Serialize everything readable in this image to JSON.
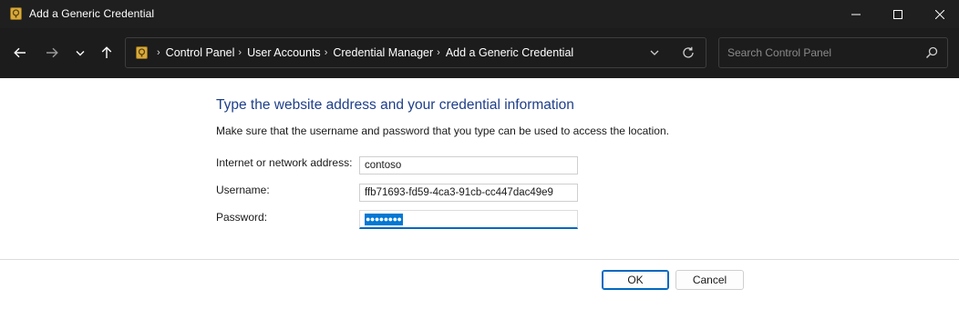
{
  "window": {
    "title": "Add a Generic Credential"
  },
  "nav": {
    "breadcrumbs": [
      "Control Panel",
      "User Accounts",
      "Credential Manager",
      "Add a Generic Credential"
    ],
    "search_placeholder": "Search Control Panel"
  },
  "form": {
    "heading": "Type the website address and your credential information",
    "instructions": "Make sure that the username and password that you type can be used to access the location.",
    "address_label": "Internet or network address:",
    "address_value": "contoso",
    "username_label": "Username:",
    "username_value": "ffb71693-fd59-4ca3-91cb-cc447dac49e9",
    "password_label": "Password:",
    "password_masked": "●●●●●●●●"
  },
  "buttons": {
    "ok_label": "OK",
    "cancel_label": "Cancel"
  },
  "icons": {
    "app": "credential-manager-icon",
    "back": "arrow-left-icon",
    "forward": "arrow-right-icon",
    "recent": "chevron-down-icon",
    "up": "arrow-up-icon",
    "refresh": "refresh-icon",
    "search": "search-icon"
  },
  "colors": {
    "accent": "#0067c0",
    "heading": "#1e3f8a",
    "titlebar": "#1f1f1f"
  }
}
